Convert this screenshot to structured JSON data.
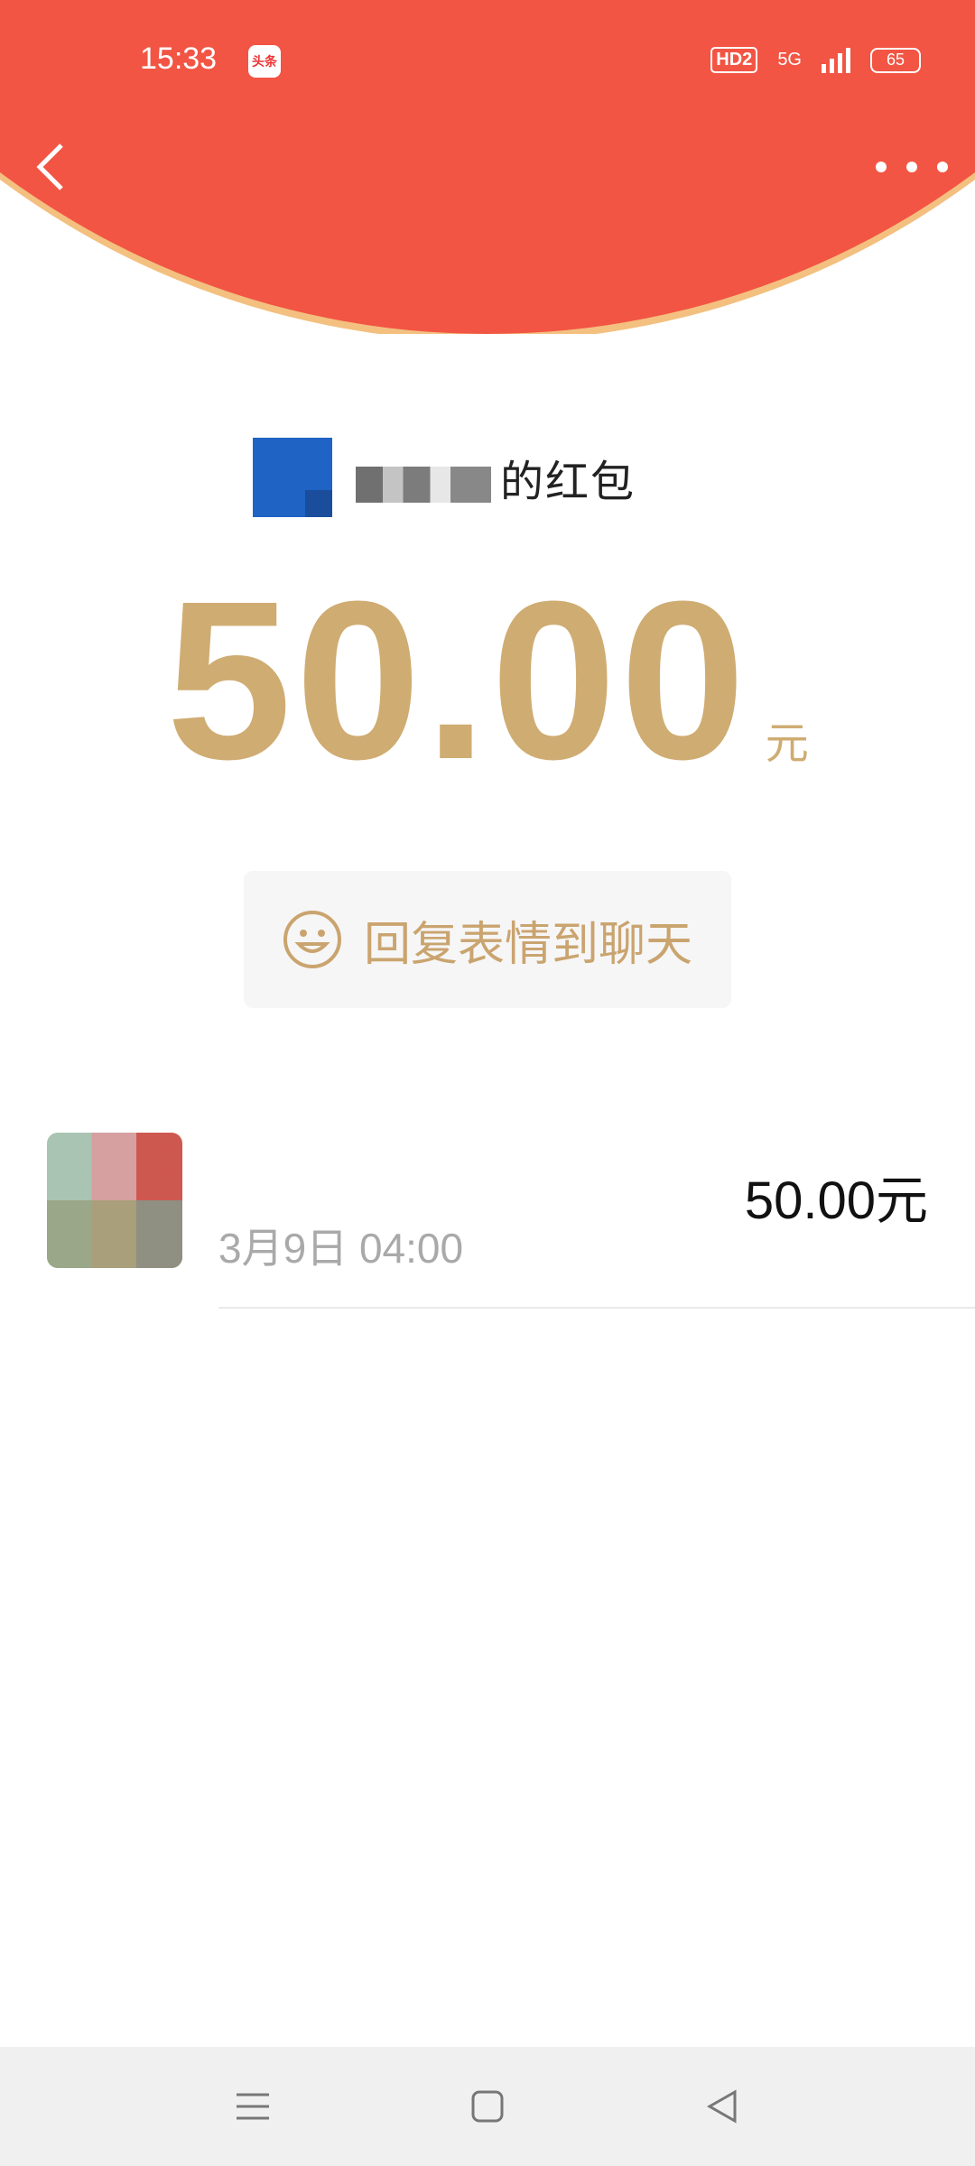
{
  "status_bar": {
    "time": "15:33",
    "app_badge": "头条",
    "hd_label": "HD2",
    "network": "5G",
    "battery": "65"
  },
  "header": {
    "back_icon": "chevron-left-icon",
    "more_icon": "more-horizontal-icon",
    "accent_color": "#f25544"
  },
  "sender": {
    "name_suffix": "的红包"
  },
  "amount": {
    "value": "50.00",
    "unit": "元",
    "color": "#cfac72"
  },
  "reply": {
    "label": "回复表情到聊天",
    "icon": "smile-icon"
  },
  "records": [
    {
      "name": "",
      "time": "3月9日  04:00",
      "amount": "50.00元"
    }
  ],
  "navbar": {
    "menu_icon": "menu-icon",
    "home_icon": "home-square-icon",
    "back_icon": "back-triangle-icon"
  }
}
